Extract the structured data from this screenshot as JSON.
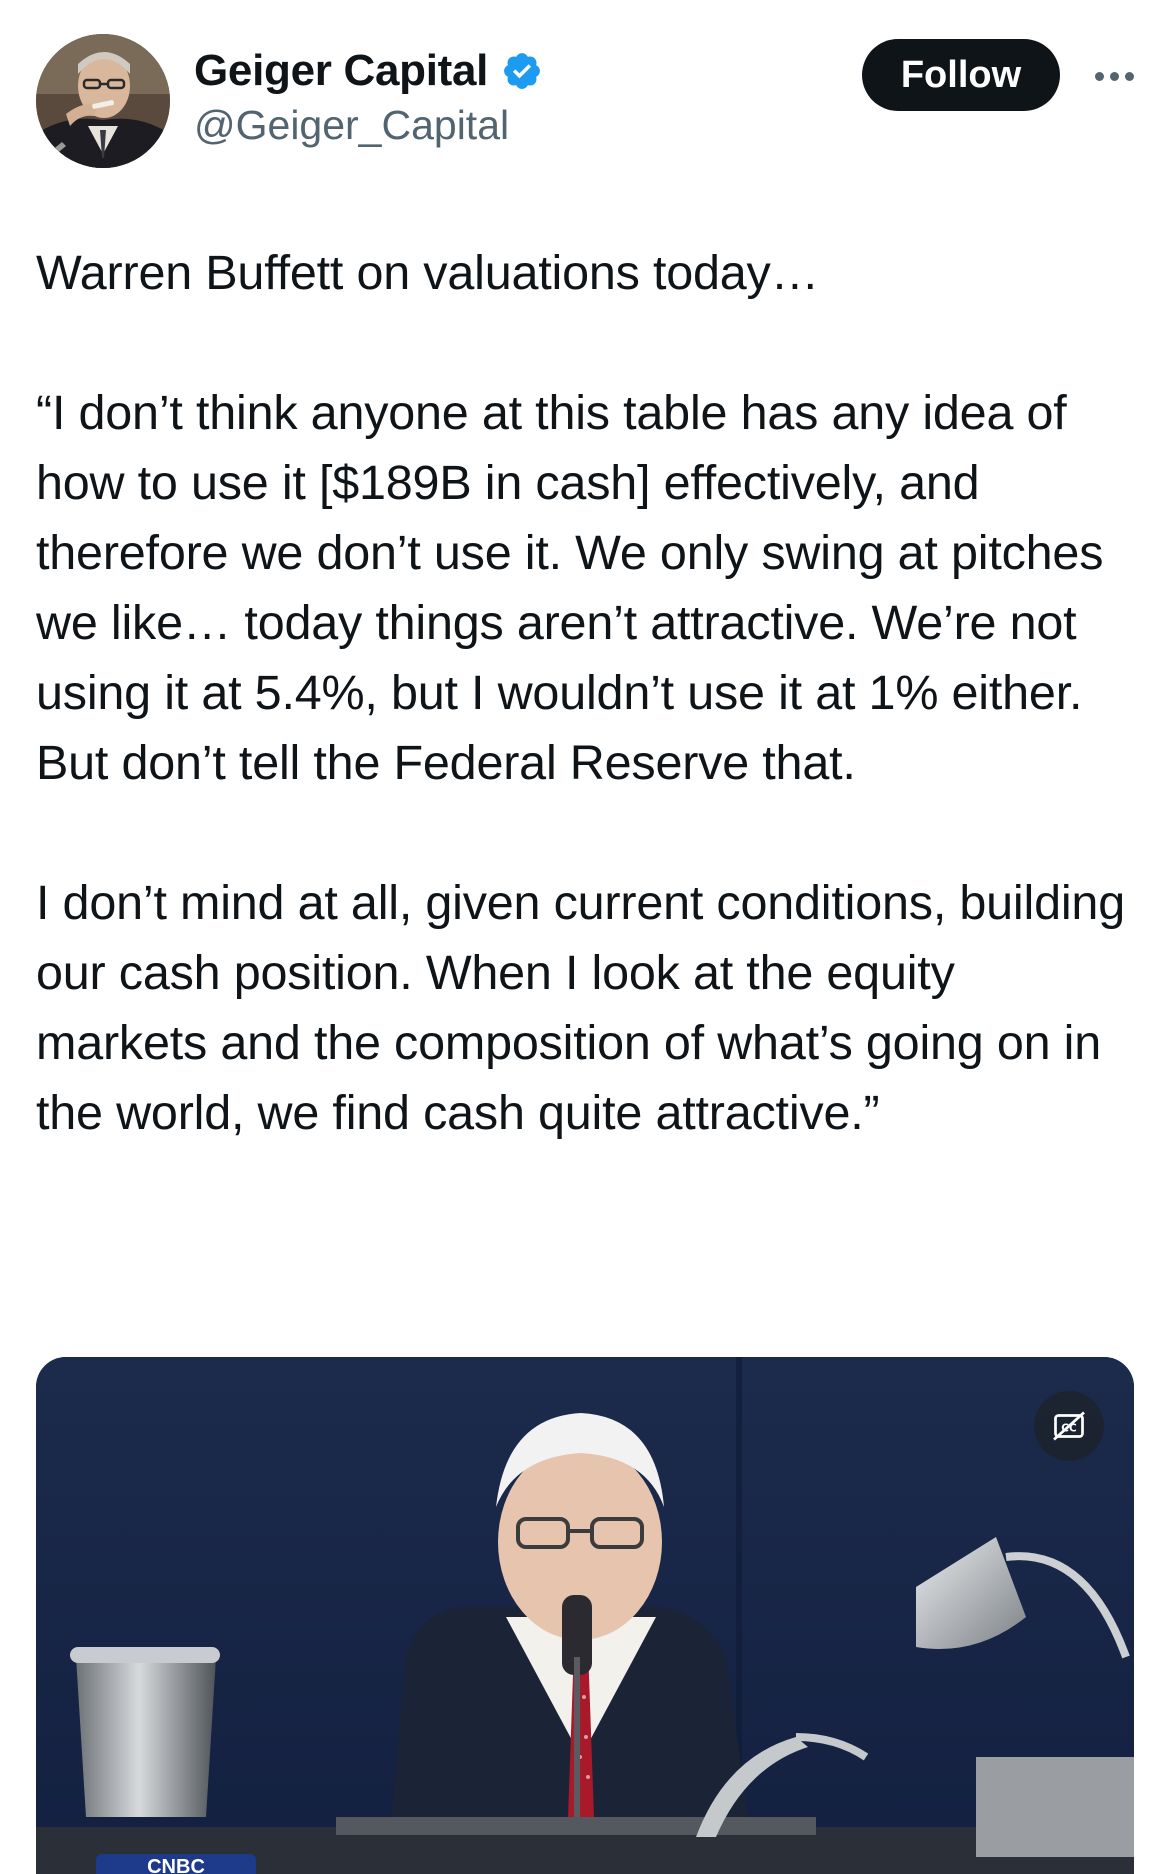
{
  "author": {
    "display_name": "Geiger Capital",
    "handle": "@Geiger_Capital",
    "verified": true,
    "verified_color": "#1d9bf0"
  },
  "actions": {
    "follow_label": "Follow",
    "more_icon": "more-horizontal-icon"
  },
  "tweet": {
    "paragraphs": [
      "Warren Buffett on valuations today…",
      "“I don’t think anyone at this table has any idea of how to use it [$189B in cash] effectively, and therefore we don’t use it. We only swing at pitches we like… today things aren’t attractive. We’re not using it at 5.4%, but I wouldn’t use it at 1% either. But don’t tell the Federal Reserve that.",
      "I don’t mind at all, given current conditions, building our cash position. When I look at the equity markets and the composition of what’s going on in the world, we find cash quite attractive.”"
    ]
  },
  "media": {
    "type": "video",
    "captions_icon": "closed-captions-off-icon",
    "network_logo_text": "CNBC"
  },
  "colors": {
    "text": "#0f1419",
    "secondary_text": "#536471",
    "follow_bg": "#0f1419",
    "follow_text": "#ffffff"
  }
}
